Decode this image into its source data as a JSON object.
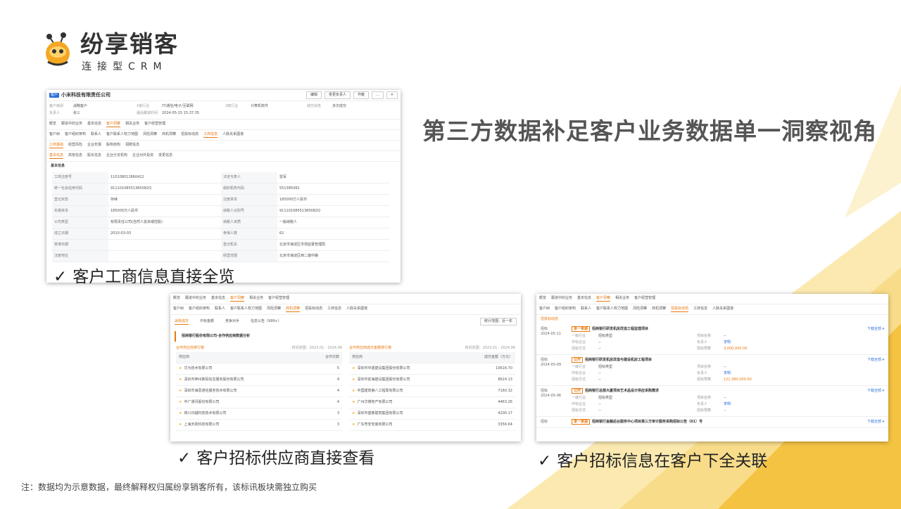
{
  "logo": {
    "name": "纷享销客",
    "sub": "连接型CRM"
  },
  "headline": "第三方数据补足客户业务数据单一洞察视角",
  "captions": {
    "c1": "客户工商信息直接全览",
    "c2": "客户招标供应商直接查看",
    "c3": "客户招标信息在客户下全关联",
    "check": "✓"
  },
  "footnote": "注：数据均为示意数据，最终解释权归属纷享销客所有，该标讯板块需独立购买",
  "colors": {
    "accent": "#e8790e",
    "yellow": "#f5c342",
    "blue": "#2f6fd8"
  },
  "shot1": {
    "tag": "客户",
    "company": "小米科技有限责任公司",
    "buttons": [
      "编辑",
      "变更负责人",
      "作废",
      "...",
      "✕"
    ],
    "info": [
      {
        "k": "客户级别",
        "v": "战略客户"
      },
      {
        "k": "1级行业",
        "v": "IT/通信/电子/互联网"
      },
      {
        "k": "2级行业",
        "v": "计算机软件"
      },
      {
        "k": "成交状态",
        "v": "多次成交"
      },
      {
        "k": "负责人",
        "v": "张三"
      },
      {
        "k": "最后跟进时间",
        "v": "2024-05-15 15:37:35"
      },
      {
        "k": "",
        "v": ""
      },
      {
        "k": "",
        "v": ""
      }
    ],
    "tabs1": [
      "概览",
      "跟进中的业务",
      "基本信息",
      "客户洞察",
      "相关业务",
      "客户经营管理"
    ],
    "tabs1_active": "客户洞察",
    "tabs2": [
      "客户树",
      "客户组织架构",
      "联系人",
      "客户联系人权力地图",
      "风险洞察",
      "商机洞察",
      "招投标动态",
      "工商信息",
      "人脉关系图谱"
    ],
    "tabs2_active": "工商信息",
    "tabs3": [
      "工商基础",
      "经营风险",
      "企业年报",
      "股权结构",
      "招聘信息"
    ],
    "tabs3_active": "工商基础",
    "tabs4": [
      "基本信息",
      "高管信息",
      "股东信息",
      "企业分支机构",
      "企业对外投资",
      "变更信息"
    ],
    "tabs4_active": "基本信息",
    "section": "基本信息",
    "kv": [
      [
        "工商注册号",
        "110108012660422",
        "法定代表人",
        "雷军"
      ],
      [
        "统一社会信用代码",
        "91110108551385082Q",
        "组织机构代码",
        "551385082"
      ],
      [
        "登记状态",
        "存续",
        "注册资本",
        "185000万人民币"
      ],
      [
        "实缴资本",
        "185000万人民币",
        "纳税人识别号",
        "91110108551385082Q"
      ],
      [
        "公司类型",
        "有限责任公司(自然人投资或控股)",
        "纳税人资质",
        "一般纳税人"
      ],
      [
        "成立日期",
        "2010-03-03",
        "参保人数",
        "62"
      ],
      [
        "核准日期",
        "",
        "登记机关",
        "北京市海淀区市场监督管理局"
      ],
      [
        "注册地址",
        "",
        "经营范围",
        "北京市海淀区西二旗中路"
      ]
    ]
  },
  "shot2": {
    "tabs1": [
      "概览",
      "跟进中的业务",
      "基本信息",
      "客户洞察",
      "相关业务",
      "客户经营管理"
    ],
    "tabs1_active": "客户洞察",
    "tabs2": [
      "客户树",
      "客户组织架构",
      "联系人",
      "客户联系人权力地图",
      "风险洞察",
      "商机洞察",
      "招投标动态",
      "工商信息",
      "人脉关系图谱"
    ],
    "tabs2_active": "商机洞察",
    "subtabs": [
      "采购成交",
      "中标金额",
      "竞争对手",
      "信息公告（999+）"
    ],
    "subtabs_active": "采购成交",
    "stat_select": "统计范围：近一年",
    "panel_title": "招商银行股份有限公司-合作供应商数据分析",
    "left": {
      "title": "合作供应商排行榜",
      "range": "时间范围：2023.01 - 2024.06",
      "head": [
        "供应商",
        "合作次数"
      ],
      "rows": [
        [
          "华为技术有限公司",
          "5"
        ],
        [
          "深圳市神州数码信息服务股份有限公司",
          "4"
        ],
        [
          "深圳市海思通信服务技术有限公司",
          "4"
        ],
        [
          "中广通讯股份有限公司",
          "4"
        ],
        [
          "四川日越科技技术有限公司",
          "3"
        ],
        [
          "上海天跃科技有限公司",
          "3"
        ]
      ]
    },
    "right": {
      "title": "合作供应商成交金额排行榜",
      "range": "时间范围：2023.01 - 2024.06",
      "head": [
        "供应商",
        "成交金额（万元）"
      ],
      "rows": [
        [
          "深圳市中建建设集团股份有限公司",
          "10616.70"
        ],
        [
          "深圳市前海建设集团股份有限公司",
          "8624.13"
        ],
        [
          "中国建筑第八工程局有限公司",
          "7160.32"
        ],
        [
          "广州华微地产有限公司",
          "4463.26"
        ],
        [
          "深圳市盛泰建筑集团有限公司",
          "4200.17"
        ],
        [
          "广东粤安安装有限公司",
          "3356.64"
        ]
      ]
    }
  },
  "shot3": {
    "tabs1": [
      "概览",
      "跟进中的业务",
      "基本信息",
      "客户洞察",
      "相关业务",
      "客户经营管理"
    ],
    "tabs1_active": "客户洞察",
    "tabs2": [
      "客户树",
      "客户组织架构",
      "联系人",
      "客户联系人权力地图",
      "风险洞察",
      "商机洞察",
      "招投标动态",
      "工商信息",
      "人脉关系图谱"
    ],
    "tabs2_active": "招投标动态",
    "section": "招投标动态",
    "more": "下载全部 ▾",
    "bids": [
      {
        "label": "招标",
        "date": "2024-05-11",
        "tag": "单一来源",
        "title": "招商银行研发机房改造工程监理项目",
        "f1": "一级行业",
        "v1": "招标类型",
        "f2": "项目名称",
        "v2": "--",
        "f3": "中标企业",
        "v3": "--",
        "f4": "负责人",
        "v4": "李明",
        "f5": "招标方式",
        "v5": "--",
        "f6": "招标预算",
        "v6": "3,000,000.00"
      },
      {
        "label": "招标",
        "date": "2024-05-09",
        "tag": "公开",
        "title": "招商银行研发机房改造与建设机房工程项目",
        "f1": "一级行业",
        "v1": "招标类型",
        "f2": "项目名称",
        "v2": "--",
        "f3": "中标企业",
        "v3": "--",
        "f4": "负责人",
        "v4": "李明",
        "f5": "招标方式",
        "v5": "--",
        "f6": "招标预算",
        "v6": "121,380,000.00"
      },
      {
        "label": "招标",
        "date": "2024-05-06",
        "tag": "公开",
        "title": "招商银行总部大厦项目艺术品设计供应采购需求",
        "f1": "一级行业",
        "v1": "招标类型",
        "f2": "项目名称",
        "v2": "--",
        "f3": "中标企业",
        "v3": "--",
        "f4": "负责人",
        "v4": "李明",
        "f5": "招标方式",
        "v5": "--",
        "f6": "招标预算",
        "v6": "--"
      },
      {
        "label": "招标",
        "date": "",
        "tag": "单一来源",
        "title": "招商银行金融后台服务中心项目第三方审计服务采购招标公告（01）号",
        "f1": "",
        "v1": "",
        "f2": "",
        "v2": "",
        "f3": "",
        "v3": "",
        "f4": "",
        "v4": "",
        "f5": "",
        "v5": "",
        "f6": "",
        "v6": ""
      }
    ]
  }
}
